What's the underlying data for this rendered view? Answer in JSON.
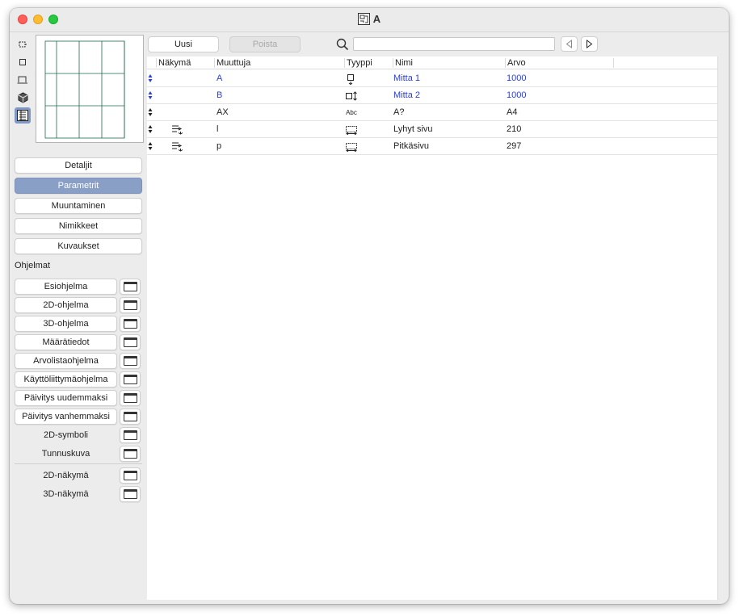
{
  "window": {
    "title": "A"
  },
  "sidebar": {
    "view_icons": [
      "selection-icon",
      "rectangle-icon",
      "plan-icon",
      "cube-icon",
      "parameters-list-icon"
    ],
    "tabs": [
      {
        "label": "Detaljit",
        "active": false
      },
      {
        "label": "Parametrit",
        "active": true
      },
      {
        "label": "Muuntaminen",
        "active": false
      },
      {
        "label": "Nimikkeet",
        "active": false
      },
      {
        "label": "Kuvaukset",
        "active": false
      }
    ],
    "programs_label": "Ohjelmat",
    "programs": [
      {
        "label": "Esiohjelma",
        "style": "button"
      },
      {
        "label": "2D-ohjelma",
        "style": "button"
      },
      {
        "label": "3D-ohjelma",
        "style": "button"
      },
      {
        "label": "Määrätiedot",
        "style": "button"
      },
      {
        "label": "Arvolistaohjelma",
        "style": "button"
      },
      {
        "label": "Käyttöliittymäohjelma",
        "style": "button"
      },
      {
        "label": "Päivitys uudemmaksi",
        "style": "button"
      },
      {
        "label": "Päivitys vanhemmaksi",
        "style": "button"
      },
      {
        "label": "2D-symboli",
        "style": "flat"
      },
      {
        "label": "Tunnuskuva",
        "style": "flat"
      }
    ],
    "views": [
      {
        "label": "2D-näkymä"
      },
      {
        "label": "3D-näkymä"
      }
    ]
  },
  "toolbar": {
    "new_label": "Uusi",
    "delete_label": "Poista",
    "search_value": "",
    "search_placeholder": ""
  },
  "table": {
    "columns": [
      "Näkymä",
      "Muuttuja",
      "Tyyppi",
      "Nimi",
      "Arvo"
    ],
    "rows": [
      {
        "variable": "A",
        "type": "length-y-icon",
        "name": "Mitta 1",
        "value": "1000",
        "highlight": true,
        "view_icon": ""
      },
      {
        "variable": "B",
        "type": "length-x-icon",
        "name": "Mitta 2",
        "value": "1000",
        "highlight": true,
        "view_icon": ""
      },
      {
        "variable": "AX",
        "type": "text-type-icon",
        "type_text": "Abc",
        "name": "A?",
        "value": "A4",
        "highlight": false,
        "view_icon": ""
      },
      {
        "variable": "l",
        "type": "dimension-icon",
        "name": "Lyhyt sivu",
        "value": "210",
        "highlight": false,
        "view_icon": "child-param-icon"
      },
      {
        "variable": "p",
        "type": "dimension-icon",
        "name": "Pitkäsivu",
        "value": "297",
        "highlight": false,
        "view_icon": "child-param-icon"
      }
    ]
  }
}
